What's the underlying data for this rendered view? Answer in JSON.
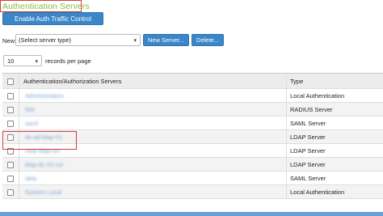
{
  "page": {
    "title": "Authentication Servers",
    "enable_button": "Enable Auth Traffic Control",
    "new_label": "New:",
    "server_type_select": "(Select server type)",
    "new_server_button": "New Server...",
    "delete_button": "Delete...",
    "page_size": "10",
    "records_label": "records per page"
  },
  "table": {
    "headers": {
      "name": "Authentication/Authorization Servers",
      "type": "Type"
    },
    "rows": [
      {
        "name": "Administrators",
        "type": "Local Authentication"
      },
      {
        "name": "Rdr",
        "type": "RADIUS Server"
      },
      {
        "name": "saml",
        "type": "SAML Server"
      },
      {
        "name": "ak-ad-ldap-01",
        "type": "LDAP Server"
      },
      {
        "name": "corp-ldap-srv",
        "type": "LDAP Server"
      },
      {
        "name": "ldap-dc-02-ssl",
        "type": "LDAP Server"
      },
      {
        "name": "okta",
        "type": "SAML Server"
      },
      {
        "name": "System Local",
        "type": "Local Authentication"
      }
    ]
  }
}
